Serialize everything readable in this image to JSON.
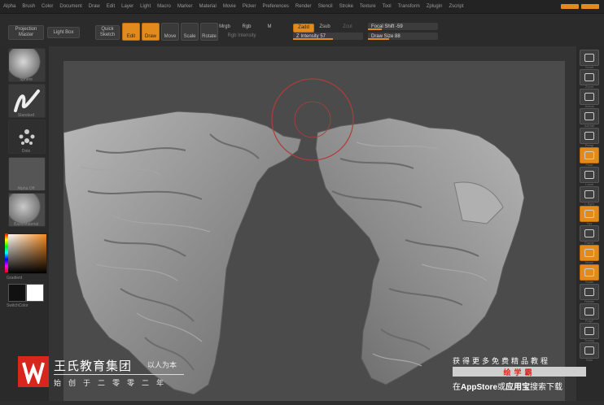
{
  "menu": {
    "items": [
      "Alpha",
      "Brush",
      "Color",
      "Document",
      "Draw",
      "Edit",
      "Layer",
      "Light",
      "Macro",
      "Marker",
      "Material",
      "Movie",
      "Picker",
      "Preferences",
      "Render",
      "Stencil",
      "Stroke",
      "Texture",
      "Tool",
      "Transform",
      "Zplugin",
      "Zscript"
    ]
  },
  "toolbar": {
    "projection_master": "Projection Master",
    "lightbox": "Light Box",
    "quick_sketch": "Quick Sketch",
    "edit": "Edit",
    "draw": "Draw",
    "move": "Move",
    "scale": "Scale",
    "rotate": "Rotate",
    "mrgb": "Mrgb",
    "rgb": "Rgb",
    "m": "M",
    "rgb_intensity": "Rgb Intensity",
    "zadd": "Zadd",
    "zsub": "Zsub",
    "zcut": "Zcut",
    "z_intensity": "Z Intensity 57",
    "focal_shift": "Focal Shift -59",
    "draw_size": "Draw Size 88",
    "z_intensity_value": 57,
    "focal_shift_value": -59,
    "draw_size_value": 88
  },
  "left_panel": {
    "labels": [
      "Sphere",
      "Standard",
      "Dots",
      "Alpha Off",
      "Texture Off",
      "BasicMaterial",
      "Gradient",
      "SwitchColor"
    ]
  },
  "right_panel": {
    "labels": [
      "Scroll",
      "Zoom",
      "Actual",
      "AAHalf",
      "Persp",
      "Floor",
      "Local",
      "L.Sym",
      "Xyz",
      "Frame",
      "Move",
      "Scale",
      "Rotate",
      "PolyF",
      "Transp",
      "Solo"
    ]
  },
  "watermark": {
    "company": "王氏教育集团",
    "slogan": "以人为本",
    "founded": "始创于二零零二年",
    "promo_line1": "获得更多免费精品教程",
    "promo_app": "绘学霸",
    "promo_line3_pre": "在",
    "promo_line3_store": "AppStore",
    "promo_line3_or": "或",
    "promo_line3_app": "应用宝",
    "promo_line3_post": "搜索下载"
  }
}
